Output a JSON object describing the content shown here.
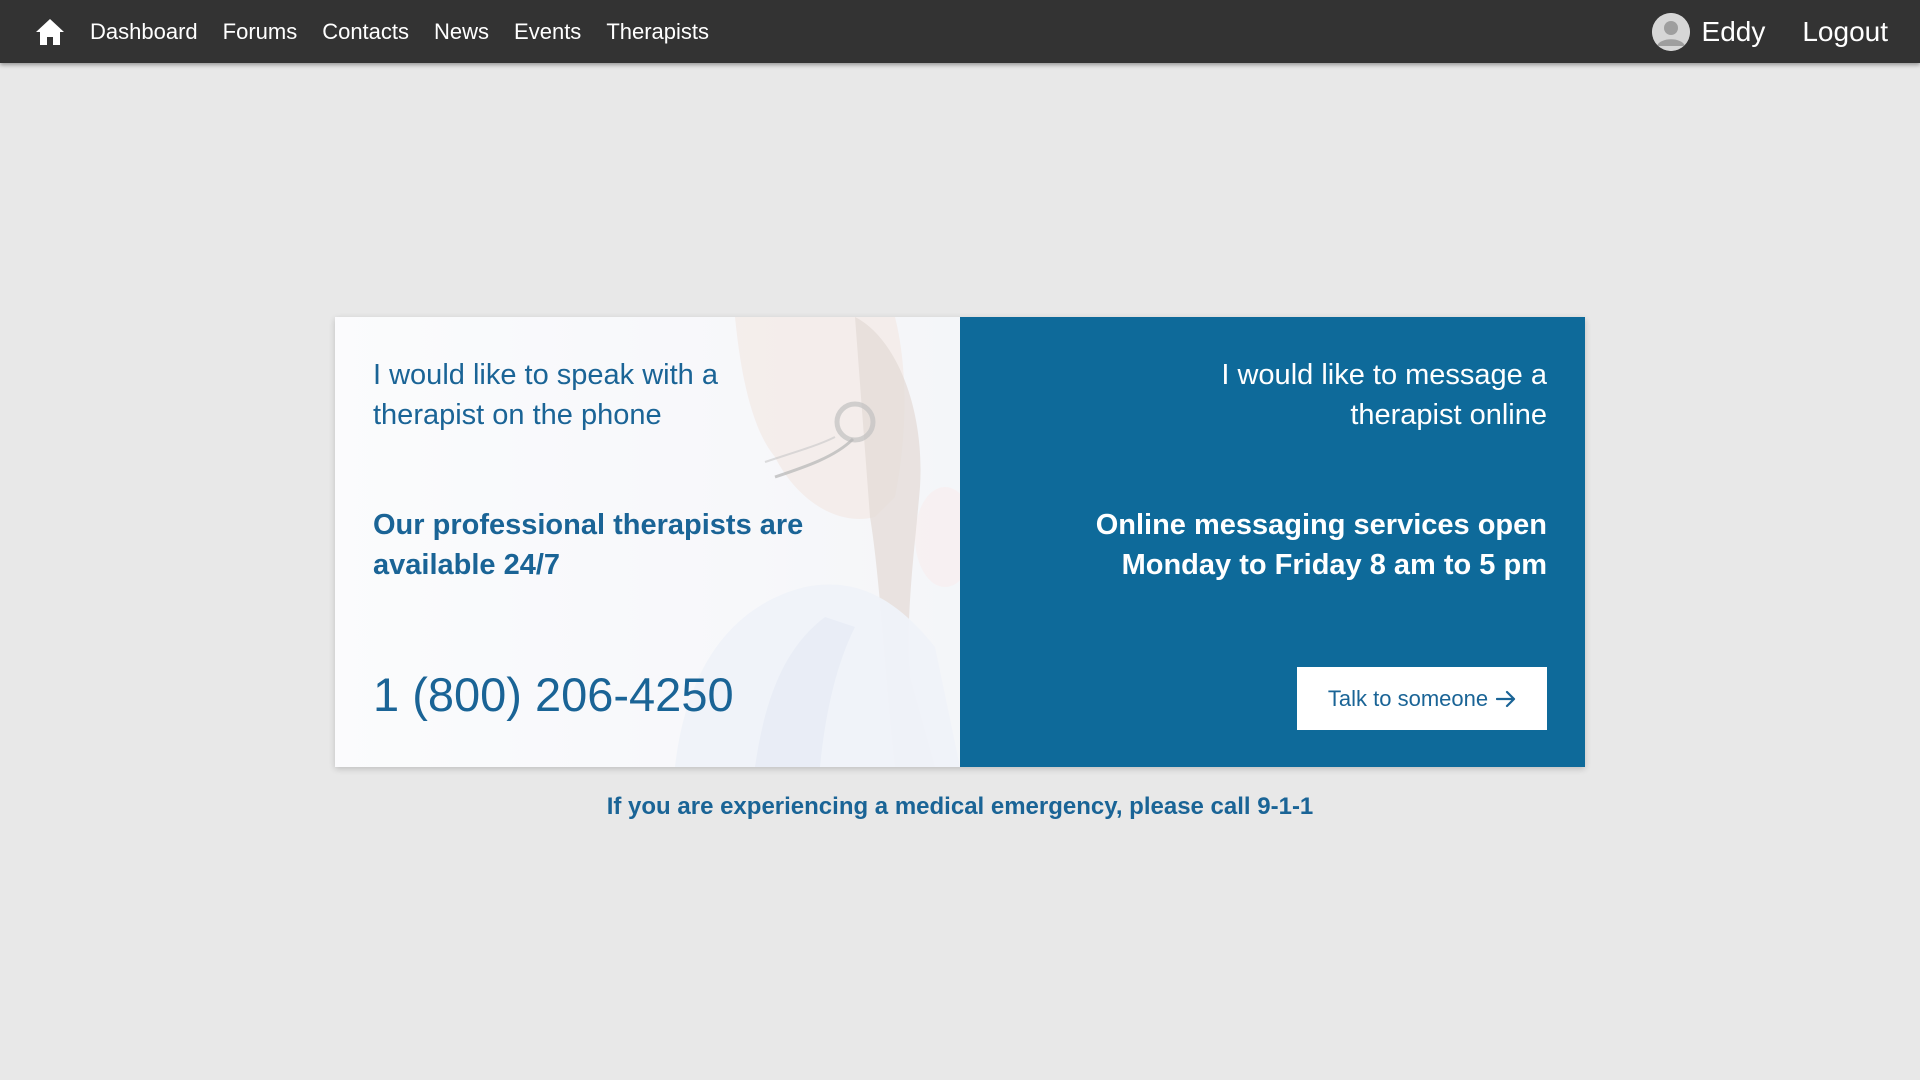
{
  "nav": {
    "home_icon": "home-icon",
    "links": [
      "Dashboard",
      "Forums",
      "Contacts",
      "News",
      "Events",
      "Therapists"
    ],
    "user": {
      "name": "Eddy",
      "avatar_icon": "user-avatar-icon"
    },
    "logout_label": "Logout"
  },
  "phone_panel": {
    "heading": "I would like to speak with a therapist on the phone",
    "subheading": "Our professional therapists are available 24/7",
    "phone_number": "1 (800) 206-4250"
  },
  "online_panel": {
    "heading": "I would like to message a therapist online",
    "subheading": "Online messaging services open Monday to Friday 8 am to 5 pm",
    "button_label": "Talk to someone",
    "button_icon": "arrow-right-icon"
  },
  "emergency_notice": "If you are experiencing a medical emergency, please call 9-1-1",
  "colors": {
    "navbar": "#333333",
    "background": "#e8e8e8",
    "primary_blue": "#0e6a9a",
    "text_blue": "#1a6496"
  }
}
